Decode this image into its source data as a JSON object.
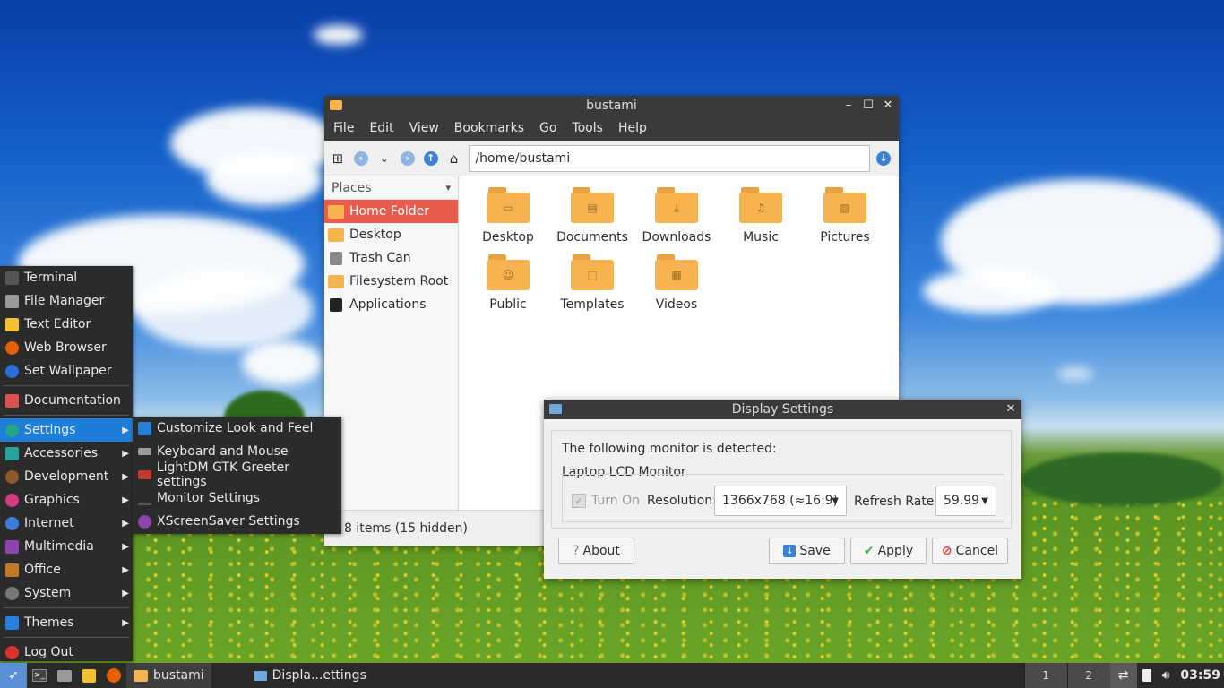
{
  "desktop": {
    "wallpaper": "sky-meadow"
  },
  "file_manager": {
    "title": "bustami",
    "menu": [
      "File",
      "Edit",
      "View",
      "Bookmarks",
      "Go",
      "Tools",
      "Help"
    ],
    "address": "/home/bustami",
    "places_header": "Places",
    "places": [
      {
        "label": "Home Folder",
        "icon": "home-folder-icon",
        "selected": true
      },
      {
        "label": "Desktop",
        "icon": "desktop-folder-icon"
      },
      {
        "label": "Trash Can",
        "icon": "trash-icon"
      },
      {
        "label": "Filesystem Root",
        "icon": "drive-icon"
      },
      {
        "label": "Applications",
        "icon": "applications-icon"
      }
    ],
    "files": [
      "Desktop",
      "Documents",
      "Downloads",
      "Music",
      "Pictures",
      "Public",
      "Templates",
      "Videos"
    ],
    "status": "8 items (15 hidden)"
  },
  "start_menu": {
    "items": [
      {
        "label": "Terminal",
        "icon": "terminal-icon",
        "color": "#3a3a3a"
      },
      {
        "label": "File Manager",
        "icon": "folder-icon",
        "color": "#8a8a8a"
      },
      {
        "label": "Text Editor",
        "icon": "text-editor-icon",
        "color": "#f1c232"
      },
      {
        "label": "Web Browser",
        "icon": "firefox-icon",
        "color": "#e66000"
      },
      {
        "label": "Set Wallpaper",
        "icon": "wallpaper-icon",
        "color": "#2a6fd6"
      },
      {
        "label": "Documentation",
        "icon": "documentation-icon",
        "color": "#d9534f"
      },
      {
        "label": "Settings",
        "icon": "settings-icon",
        "color": "#27a58a",
        "submenu": true
      },
      {
        "label": "Accessories",
        "icon": "accessories-icon",
        "color": "#2aa198",
        "submenu": true
      },
      {
        "label": "Development",
        "icon": "development-icon",
        "color": "#8b5a2b",
        "submenu": true
      },
      {
        "label": "Graphics",
        "icon": "graphics-icon",
        "color": "#d43d82",
        "submenu": true
      },
      {
        "label": "Internet",
        "icon": "internet-icon",
        "color": "#3b7dd8",
        "submenu": true
      },
      {
        "label": "Multimedia",
        "icon": "multimedia-icon",
        "color": "#8e44ad",
        "submenu": true
      },
      {
        "label": "Office",
        "icon": "office-icon",
        "color": "#c0782a",
        "submenu": true
      },
      {
        "label": "System",
        "icon": "system-icon",
        "color": "#777777",
        "submenu": true
      },
      {
        "label": "Themes",
        "icon": "themes-icon",
        "color": "#2a7fd6",
        "submenu": true
      },
      {
        "label": "Log Out",
        "icon": "logout-icon",
        "color": "#d9342b"
      }
    ]
  },
  "settings_submenu": {
    "items": [
      {
        "label": "Customize Look and Feel",
        "icon": "customize-icon",
        "color": "#2a7fd6"
      },
      {
        "label": "Keyboard and Mouse",
        "icon": "keyboard-icon",
        "color": "#9a9a9a"
      },
      {
        "label": "LightDM GTK Greeter settings",
        "icon": "greeter-icon",
        "color": "#c0392b"
      },
      {
        "label": "Monitor Settings",
        "icon": "monitor-icon",
        "color": "#555555"
      },
      {
        "label": "XScreenSaver Settings",
        "icon": "screensaver-icon",
        "color": "#8e44ad"
      }
    ]
  },
  "display_dialog": {
    "title": "Display Settings",
    "detected_text": "The following monitor is detected:",
    "monitor_label": "Laptop LCD Monitor",
    "turn_on_label": "Turn On",
    "resolution_label": "Resolution:",
    "resolution_value": "1366x768 (≈16:9)",
    "refresh_label": "Refresh Rate:",
    "refresh_value": "59.99",
    "about_label": "About",
    "save_label": "Save",
    "apply_label": "Apply",
    "cancel_label": "Cancel"
  },
  "taskbar": {
    "tasks": [
      {
        "label": "bustami",
        "icon": "folder-icon"
      },
      {
        "label": "Displa...ettings",
        "icon": "monitor-icon"
      }
    ],
    "workspaces": [
      "1",
      "2"
    ],
    "clock": "03:59"
  }
}
